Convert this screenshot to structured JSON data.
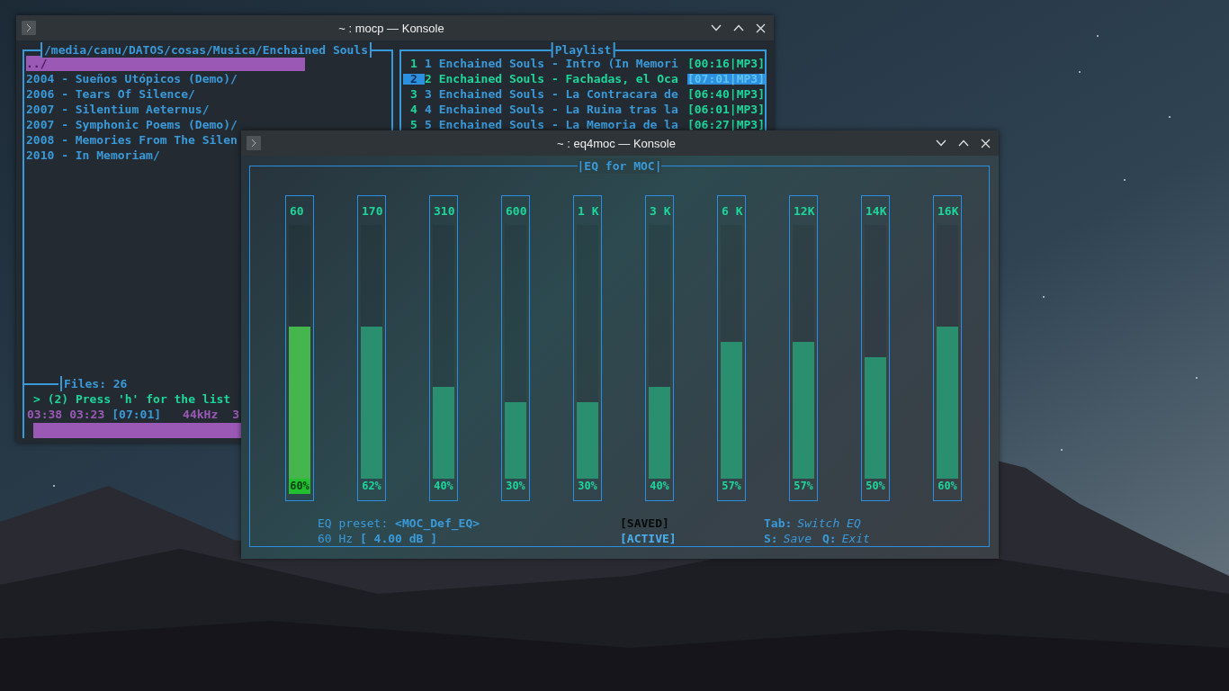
{
  "windows": [
    {
      "title": "~ : mocp — Konsole",
      "kind": "mocp",
      "browser": {
        "path": "/media/canu/DATOS/cosas/Musica/Enchained Souls",
        "items": [
          {
            "label": "../",
            "selected": true
          },
          {
            "label": "2004 - Sueños Utópicos (Demo)/",
            "selected": false
          },
          {
            "label": "2006 - Tears Of Silence/",
            "selected": false
          },
          {
            "label": "2007 - Silentium Aeternus/",
            "selected": false
          },
          {
            "label": "2007 - Symphonic Poems (Demo)/",
            "selected": false
          },
          {
            "label": "2008 - Memories From The Silen",
            "selected": false
          },
          {
            "label": "2010 - In Memoriam/",
            "selected": false
          }
        ]
      },
      "playlist": {
        "title": "Playlist",
        "rows": [
          {
            "number": "1",
            "title": "1 Enchained Souls - Intro (In Memori",
            "time": "[00:16|MP3]",
            "selected": false
          },
          {
            "number": "2",
            "title": "2 Enchained Souls - Fachadas, el Oca",
            "time": "[07:01|MP3]",
            "selected": true
          },
          {
            "number": "3",
            "title": "3 Enchained Souls - La Contracara de",
            "time": "[06:40|MP3]",
            "selected": false
          },
          {
            "number": "4",
            "title": "4 Enchained Souls - La Ruina tras la",
            "time": "[06:01|MP3]",
            "selected": false
          },
          {
            "number": "5",
            "title": "5 Enchained Souls - La Memoria de la",
            "time": "[06:27|MP3]",
            "selected": false
          }
        ]
      },
      "files": "Files: 26",
      "progress": {
        "level": 1
      },
      "message": "> (2) Press 'h' for the list",
      "status": [
        {
          "text": "03:38",
          "color": "#9b59b6"
        },
        {
          "text": "03:23",
          "color": "#9b59b6"
        },
        {
          "text": "[07:01]",
          "color": "#3a9ad9"
        },
        {
          "text": "44kHz",
          "color": "#9b59b6"
        },
        {
          "text": "3",
          "color": "#9b59b6"
        }
      ]
    },
    {
      "title": "~ : eq4moc — Konsole",
      "kind": "eq",
      "frame_title": "|EQ for MOC|",
      "bands": [
        {
          "label": "60",
          "level": 0.6,
          "reading": "60%",
          "selected": true
        },
        {
          "label": "170",
          "level": 0.6,
          "reading": "62%",
          "selected": false
        },
        {
          "label": "310",
          "level": 0.36,
          "reading": "40%",
          "selected": false
        },
        {
          "label": "600",
          "level": 0.3,
          "reading": "30%",
          "selected": false
        },
        {
          "label": "1 K",
          "level": 0.3,
          "reading": "30%",
          "selected": false
        },
        {
          "label": "3 K",
          "level": 0.36,
          "reading": "40%",
          "selected": false
        },
        {
          "label": "6 K",
          "level": 0.54,
          "reading": "57%",
          "selected": false
        },
        {
          "label": "12K",
          "level": 0.54,
          "reading": "57%",
          "selected": false
        },
        {
          "label": "14K",
          "level": 0.48,
          "reading": "50%",
          "selected": false
        },
        {
          "label": "16K",
          "level": 0.6,
          "reading": "60%",
          "selected": false
        }
      ],
      "preset_label": "EQ preset:",
      "preset": "<MOC_Def_EQ>",
      "freq_label": "60 Hz",
      "gain": "[ 4.00 dB ]",
      "flags": [
        {
          "text": "[SAVED]",
          "on": false
        },
        {
          "text": "[ACTIVE]",
          "on": true
        }
      ],
      "keys": [
        [
          {
            "key": "Tab:",
            "action": "Switch EQ"
          }
        ],
        [
          {
            "key": "S:",
            "action": "Save"
          },
          {
            "key": "Q:",
            "action": "Exit"
          }
        ]
      ]
    }
  ]
}
